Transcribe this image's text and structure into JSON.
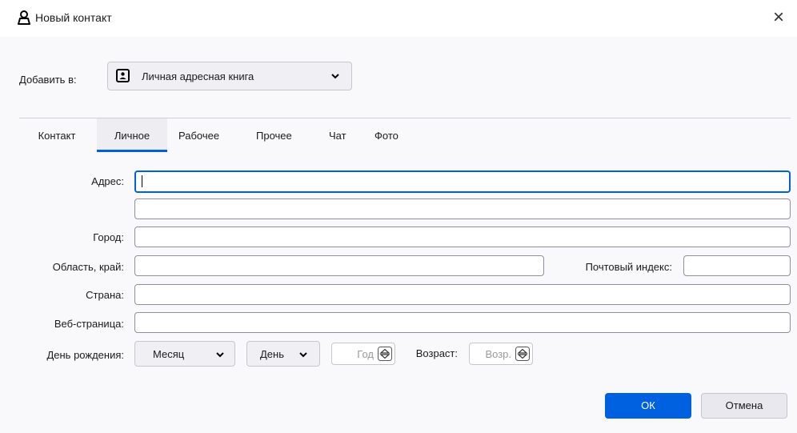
{
  "window": {
    "title": "Новый контакт",
    "close_glyph": "×"
  },
  "add_to": {
    "label": "Добавить в:",
    "book": "Личная адресная книга"
  },
  "tabs": [
    "Контакт",
    "Личное",
    "Рабочее",
    "Прочее",
    "Чат",
    "Фото"
  ],
  "active_tab": "Личное",
  "fields": {
    "address_label": "Адрес:",
    "city_label": "Город:",
    "region_label": "Область, край:",
    "postal_label": "Почтовый индекс:",
    "country_label": "Страна:",
    "web_label": "Веб-страница:",
    "birthday_label": "День рождения:",
    "month": "Месяц",
    "day": "День",
    "year_placeholder": "Год",
    "age_label": "Возраст:",
    "age_placeholder": "Возр."
  },
  "buttons": {
    "ok": "ОК",
    "cancel": "Отмена"
  },
  "colors": {
    "accent": "#0061e0",
    "background": "#f9f9fb"
  },
  "icons": {
    "title": "person-icon",
    "book": "address-book-icon",
    "dropdown": "chevron-down-icon",
    "spinner": "spinner-icon",
    "close": "close-icon"
  }
}
